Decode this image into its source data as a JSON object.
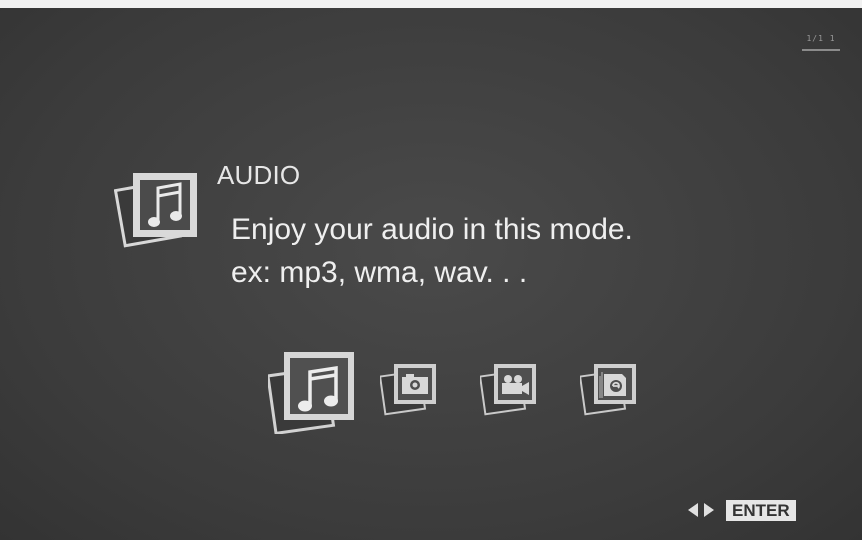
{
  "header": {
    "badge_text": "1/1 1"
  },
  "selected_mode": {
    "title": "AUDIO",
    "description_line1": "Enjoy your audio in this mode.",
    "description_line2": "ex: mp3, wma, wav. . ."
  },
  "modes": [
    {
      "name": "audio",
      "icon": "music-note-icon",
      "selected": true
    },
    {
      "name": "photo",
      "icon": "camera-icon",
      "selected": false
    },
    {
      "name": "video",
      "icon": "video-camera-icon",
      "selected": false
    },
    {
      "name": "ebook",
      "icon": "ebook-icon",
      "selected": false
    }
  ],
  "footer": {
    "enter_label": "ENTER"
  }
}
